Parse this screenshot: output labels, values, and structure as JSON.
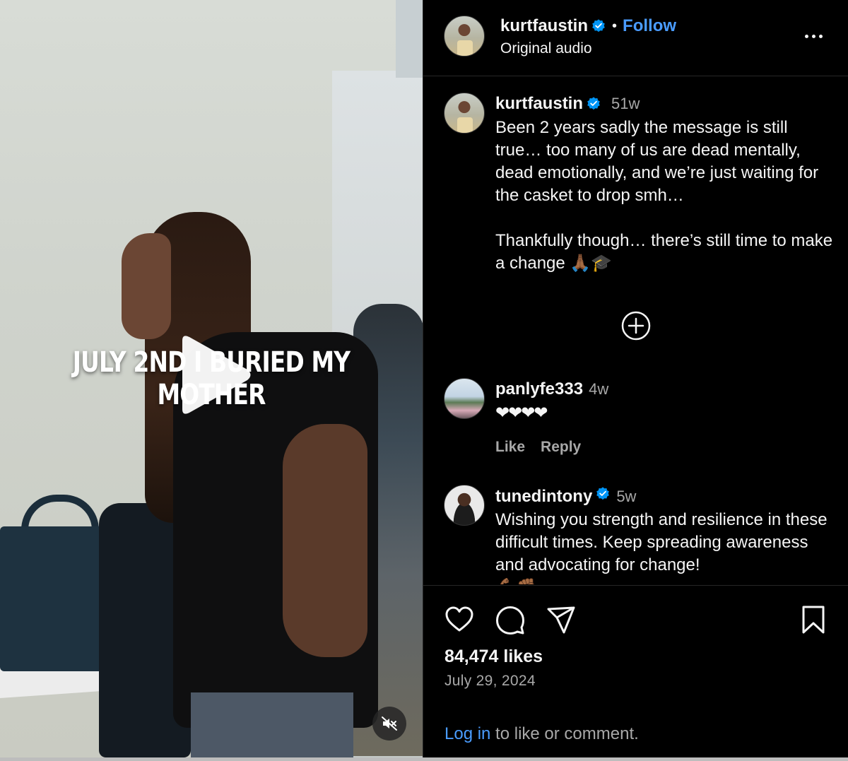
{
  "video": {
    "overlay_text": "JULY 2ND I BURIED MY MOTHER"
  },
  "header": {
    "username": "kurtfaustin",
    "separator": "•",
    "follow_label": "Follow",
    "audio_label": "Original audio"
  },
  "caption": {
    "username": "kurtfaustin",
    "time": "51w",
    "text": "Been 2 years sadly the message is still true… too many of us are dead mentally, dead emotionally, and we’re just waiting for the casket to drop smh…\n\nThankfully though… there’s still time to make a change 🙏🏾🎓"
  },
  "comments": [
    {
      "username": "panlyfe333",
      "time": "4w",
      "text": "❤❤❤❤",
      "like_label": "Like",
      "reply_label": "Reply"
    },
    {
      "username": "tunedintony",
      "time": "5w",
      "text": "Wishing you strength and resilience in these difficult times. Keep spreading awareness and advocating for change!",
      "trailing_emoji": "💪🏾✊🏾"
    }
  ],
  "footer": {
    "likes": "84,474 likes",
    "date": "July 29, 2024",
    "login_link": "Log in",
    "login_rest": " to like or comment."
  },
  "colors": {
    "accent": "#4a9cff",
    "background": "#000000",
    "text": "#f5f5f5",
    "muted": "#a8a8a8",
    "verified": "#0095f6"
  },
  "icons": [
    "play-icon",
    "mute-icon",
    "verified-icon",
    "more-icon",
    "add-circle-icon",
    "heart-icon",
    "comment-icon",
    "share-icon",
    "bookmark-icon"
  ]
}
